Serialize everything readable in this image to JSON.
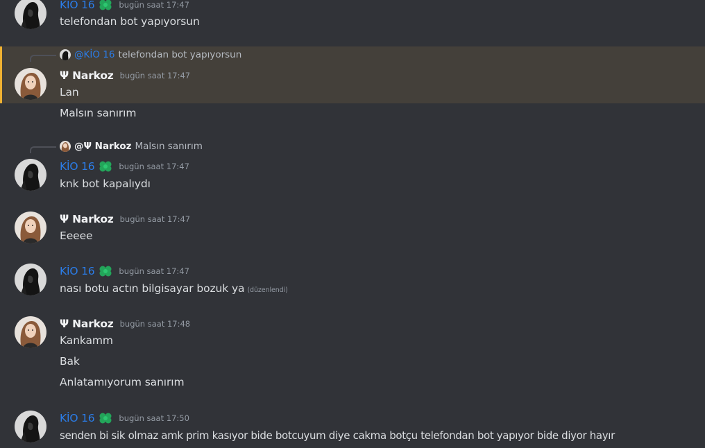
{
  "users": {
    "kio": {
      "name": "KİO 16",
      "color": "#2b7de9",
      "badge_icon": "clover-badge-icon",
      "badge_color": "#23a55a"
    },
    "narkoz": {
      "name": "Ψ Narkoz",
      "color": "#f2f3f5"
    }
  },
  "highlight_color": "#f0b232",
  "messages": [
    {
      "author": "KİO 16",
      "timestamp": "bugün saat 17:47",
      "lines": [
        "telefondan bot yapıyorsun"
      ]
    },
    {
      "author": "Ψ Narkoz",
      "timestamp": "bugün saat 17:47",
      "reply_to": {
        "mention": "@KİO 16",
        "text": "telefondan bot yapıyorsun"
      },
      "lines": [
        "Lan",
        "Malsın sanırım"
      ]
    },
    {
      "author": "KİO 16",
      "timestamp": "bugün saat 17:47",
      "reply_to": {
        "mention": "@Ψ Narkoz",
        "text": "Malsın sanırım"
      },
      "lines": [
        "knk bot kapalıydı"
      ]
    },
    {
      "author": "Ψ Narkoz",
      "timestamp": "bugün saat 17:47",
      "lines": [
        "Eeeee"
      ]
    },
    {
      "author": "KİO 16",
      "timestamp": "bugün saat 17:47",
      "lines": [
        "nası botu actın bilgisayar bozuk ya"
      ],
      "edited": "(düzenlendi)"
    },
    {
      "author": "Ψ Narkoz",
      "timestamp": "bugün saat 17:48",
      "lines": [
        "Kankamm",
        "Bak",
        "Anlatamıyorum sanırım"
      ]
    },
    {
      "author": "KİO 16",
      "timestamp": "bugün saat 17:50",
      "lines": [
        "senden bi sik olmaz amk prim kasıyor bide botcuyum diye cakma botçu telefondan bot yapıyor bide diyor hayır"
      ]
    }
  ]
}
